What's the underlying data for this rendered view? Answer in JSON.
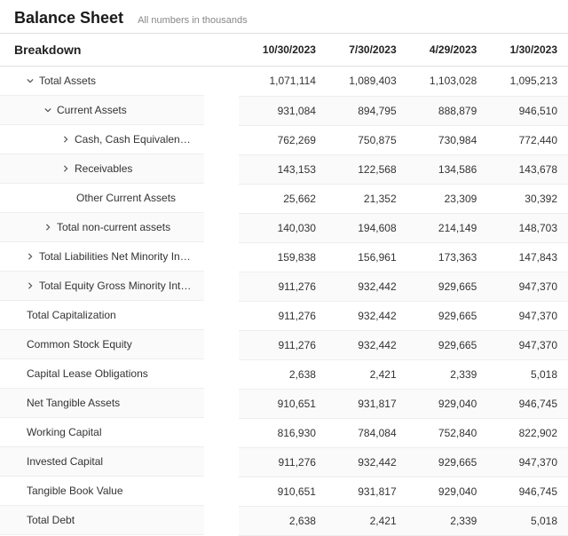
{
  "header": {
    "title": "Balance Sheet",
    "subtitle": "All numbers in thousands"
  },
  "columns": {
    "breakdown": "Breakdown",
    "c0": "10/30/2023",
    "c1": "7/30/2023",
    "c2": "4/29/2023",
    "c3": "1/30/2023"
  },
  "rows": [
    {
      "icon": "chevron-down",
      "indent": 1,
      "label": "Total Assets",
      "v": [
        "1,071,114",
        "1,089,403",
        "1,103,028",
        "1,095,213"
      ]
    },
    {
      "icon": "chevron-down",
      "indent": 2,
      "label": "Current Assets",
      "v": [
        "931,084",
        "894,795",
        "888,879",
        "946,510"
      ]
    },
    {
      "icon": "chevron-right",
      "indent": 3,
      "label": "Cash, Cash Equivalents & S…",
      "v": [
        "762,269",
        "750,875",
        "730,984",
        "772,440"
      ]
    },
    {
      "icon": "chevron-right",
      "indent": 3,
      "label": "Receivables",
      "v": [
        "143,153",
        "122,568",
        "134,586",
        "143,678"
      ]
    },
    {
      "icon": "",
      "indent": 4,
      "label": "Other Current Assets",
      "v": [
        "25,662",
        "21,352",
        "23,309",
        "30,392"
      ]
    },
    {
      "icon": "chevron-right",
      "indent": 2,
      "label": "Total non-current assets",
      "v": [
        "140,030",
        "194,608",
        "214,149",
        "148,703"
      ]
    },
    {
      "icon": "chevron-right",
      "indent": 1,
      "label": "Total Liabilities Net Minority Int…",
      "v": [
        "159,838",
        "156,961",
        "173,363",
        "147,843"
      ]
    },
    {
      "icon": "chevron-right",
      "indent": 1,
      "label": "Total Equity Gross Minority Inte…",
      "v": [
        "911,276",
        "932,442",
        "929,665",
        "947,370"
      ]
    },
    {
      "icon": "",
      "indent": 1,
      "label": "Total Capitalization",
      "v": [
        "911,276",
        "932,442",
        "929,665",
        "947,370"
      ]
    },
    {
      "icon": "",
      "indent": 1,
      "label": "Common Stock Equity",
      "v": [
        "911,276",
        "932,442",
        "929,665",
        "947,370"
      ]
    },
    {
      "icon": "",
      "indent": 1,
      "label": "Capital Lease Obligations",
      "v": [
        "2,638",
        "2,421",
        "2,339",
        "5,018"
      ]
    },
    {
      "icon": "",
      "indent": 1,
      "label": "Net Tangible Assets",
      "v": [
        "910,651",
        "931,817",
        "929,040",
        "946,745"
      ]
    },
    {
      "icon": "",
      "indent": 1,
      "label": "Working Capital",
      "v": [
        "816,930",
        "784,084",
        "752,840",
        "822,902"
      ]
    },
    {
      "icon": "",
      "indent": 1,
      "label": "Invested Capital",
      "v": [
        "911,276",
        "932,442",
        "929,665",
        "947,370"
      ]
    },
    {
      "icon": "",
      "indent": 1,
      "label": "Tangible Book Value",
      "v": [
        "910,651",
        "931,817",
        "929,040",
        "946,745"
      ]
    },
    {
      "icon": "",
      "indent": 1,
      "label": "Total Debt",
      "v": [
        "2,638",
        "2,421",
        "2,339",
        "5,018"
      ]
    }
  ]
}
